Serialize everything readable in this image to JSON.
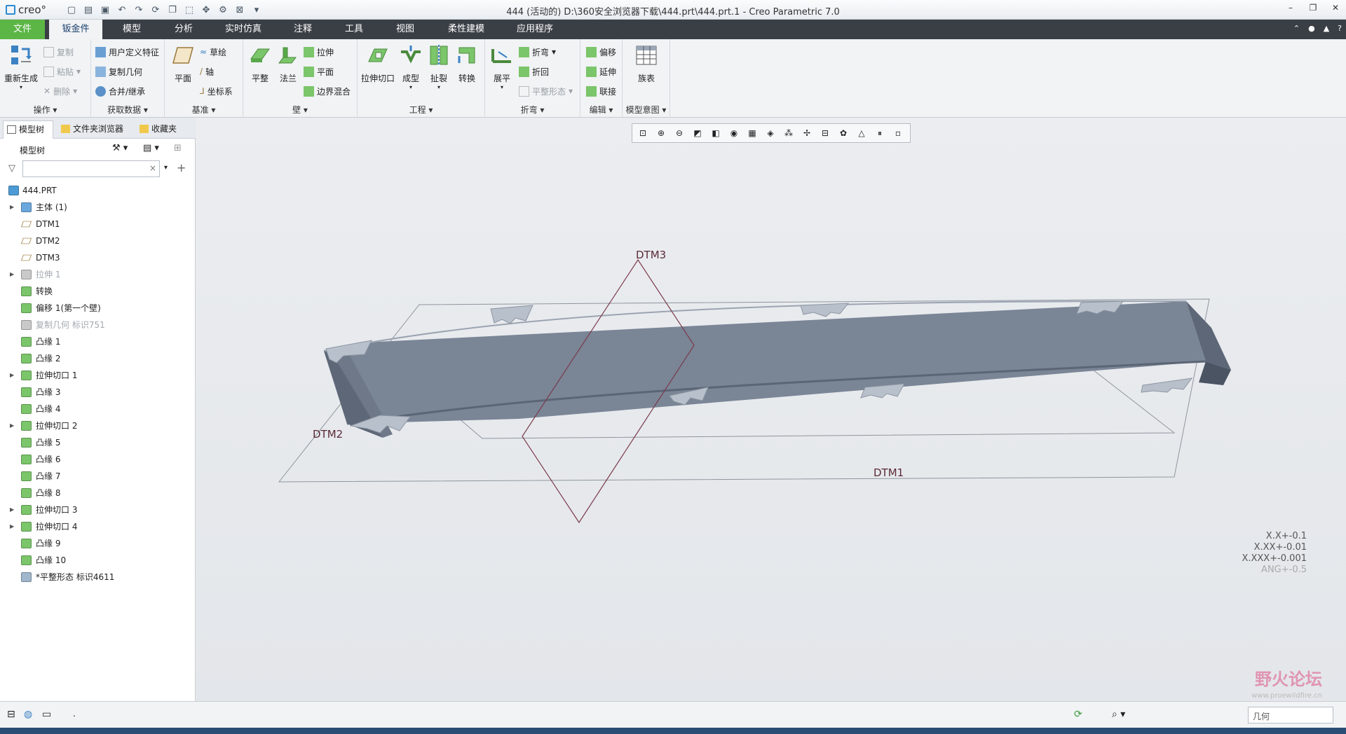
{
  "window": {
    "app_logo": "creo°",
    "title": "444 (活动的) D:\\360安全浏览器下载\\444.prt\\444.prt.1 - Creo Parametric 7.0",
    "controls": [
      "–",
      "❐",
      "✕"
    ]
  },
  "menu": {
    "tabs": [
      "文件",
      "钣金件",
      "模型",
      "分析",
      "实时仿真",
      "注释",
      "工具",
      "视图",
      "柔性建模",
      "应用程序"
    ],
    "active": "钣金件",
    "right_icons": [
      "up-arrow-icon",
      "user-icon",
      "cap-icon",
      "help-icon"
    ]
  },
  "ribbon": {
    "operations": {
      "label": "操作",
      "regen": "重新生成",
      "copy": "复制",
      "paste": "粘贴",
      "delete": "删除"
    },
    "get_data": {
      "label": "获取数据",
      "udf": "用户定义特征",
      "copy_geom": "复制几何",
      "merge": "合并/继承"
    },
    "datum": {
      "label": "基准",
      "plane": "平面",
      "sketch": "草绘",
      "axis": "轴",
      "csys": "坐标系"
    },
    "wall": {
      "label": "壁",
      "flat": "平整",
      "flange": "法兰",
      "extrude": "拉伸",
      "planar": "平面",
      "blend": "边界混合"
    },
    "engineering": {
      "label": "工程",
      "extrude_cut": "拉伸切口",
      "form": "成型",
      "rip": "扯裂",
      "convert": "转换"
    },
    "bend": {
      "label": "折弯",
      "unbend": "展平",
      "bend": "折弯",
      "bend_back": "折回",
      "flat_state": "平整形态"
    },
    "edit": {
      "label": "编辑",
      "offset": "偏移",
      "extend": "延伸",
      "join": "联接"
    },
    "model_intent": {
      "label": "模型意图",
      "family_table": "族表"
    }
  },
  "panel": {
    "tabs": [
      "模型树",
      "文件夹浏览器",
      "收藏夹"
    ],
    "tree_label": "模型树",
    "filter_placeholder": "",
    "filter_clear": "×",
    "items": [
      {
        "label": "444.PRT",
        "icon": "part-icon",
        "expand": "",
        "dim": false
      },
      {
        "label": "主体 (1)",
        "icon": "body-icon",
        "expand": "▶",
        "dim": false
      },
      {
        "label": "DTM1",
        "icon": "datum-plane-icon",
        "expand": "",
        "dim": false
      },
      {
        "label": "DTM2",
        "icon": "datum-plane-icon",
        "expand": "",
        "dim": false
      },
      {
        "label": "DTM3",
        "icon": "datum-plane-icon",
        "expand": "",
        "dim": false
      },
      {
        "label": "拉伸 1",
        "icon": "extrude-icon",
        "expand": "▶",
        "dim": true
      },
      {
        "label": "转换",
        "icon": "convert-icon",
        "expand": "",
        "dim": false
      },
      {
        "label": "偏移 1(第一个壁)",
        "icon": "offset-wall-icon",
        "expand": "",
        "dim": false
      },
      {
        "label": "复制几何 标识751",
        "icon": "copy-geom-icon",
        "expand": "",
        "dim": true
      },
      {
        "label": "凸缘 1",
        "icon": "flange-icon",
        "expand": "",
        "dim": false
      },
      {
        "label": "凸缘 2",
        "icon": "flange-icon",
        "expand": "",
        "dim": false
      },
      {
        "label": "拉伸切口 1",
        "icon": "extrude-cut-icon",
        "expand": "▶",
        "dim": false
      },
      {
        "label": "凸缘 3",
        "icon": "flange-icon",
        "expand": "",
        "dim": false
      },
      {
        "label": "凸缘 4",
        "icon": "flange-icon",
        "expand": "",
        "dim": false
      },
      {
        "label": "拉伸切口 2",
        "icon": "extrude-cut-icon",
        "expand": "▶",
        "dim": false
      },
      {
        "label": "凸缘 5",
        "icon": "flange-icon",
        "expand": "",
        "dim": false
      },
      {
        "label": "凸缘 6",
        "icon": "flange-icon",
        "expand": "",
        "dim": false
      },
      {
        "label": "凸缘 7",
        "icon": "flange-icon",
        "expand": "",
        "dim": false
      },
      {
        "label": "凸缘 8",
        "icon": "flange-icon",
        "expand": "",
        "dim": false
      },
      {
        "label": "拉伸切口 3",
        "icon": "extrude-cut-icon",
        "expand": "▶",
        "dim": false
      },
      {
        "label": "拉伸切口 4",
        "icon": "extrude-cut-icon",
        "expand": "▶",
        "dim": false
      },
      {
        "label": "凸缘 9",
        "icon": "flange-icon",
        "expand": "",
        "dim": false
      },
      {
        "label": "凸缘 10",
        "icon": "flange-icon",
        "expand": "",
        "dim": false
      },
      {
        "label": "*平整形态 标识4611",
        "icon": "flat-state-icon",
        "expand": "",
        "dim": false
      }
    ]
  },
  "graphics": {
    "datums": {
      "dtm1": "DTM1",
      "dtm2": "DTM2",
      "dtm3": "DTM3"
    },
    "tolerances": [
      "X.X+-0.1",
      "X.XX+-0.01",
      "X.XXX+-0.001",
      "ANG+-0.5"
    ],
    "watermark": "野火论坛",
    "watermark_url": "www.proewildfire.cn"
  },
  "status": {
    "text": ".",
    "selection_filter": "几何"
  },
  "colors": {
    "file_tab": "#5cb646",
    "menubar": "#3a3f46",
    "part_top": "#7a8596",
    "part_side": "#5d6777",
    "datum_line": "#7a3b4a"
  }
}
